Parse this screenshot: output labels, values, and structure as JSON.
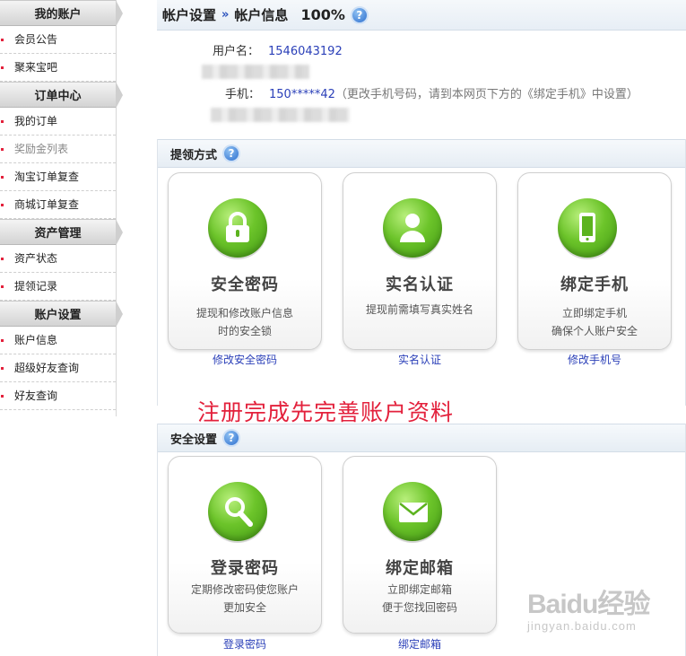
{
  "sidebar": {
    "groups": [
      {
        "title": "我的账户",
        "items": [
          "会员公告",
          "聚来宝吧"
        ]
      },
      {
        "title": "订单中心",
        "items": [
          "我的订单",
          "奖励金列表",
          "淘宝订单复查",
          "商城订单复查"
        ]
      },
      {
        "title": "资产管理",
        "items": [
          "资产状态",
          "提领记录"
        ]
      },
      {
        "title": "账户设置",
        "items": [
          "账户信息",
          "超级好友查询",
          "好友查询"
        ]
      }
    ]
  },
  "header": {
    "crumb1": "帐户设置",
    "sep": "»",
    "crumb2": "帐户信息",
    "percent": "100%",
    "help": "?"
  },
  "account": {
    "username_label": "用户名：",
    "username": "1546043192",
    "phone_label": "手机：",
    "phone": "150*****42",
    "phone_note": "（更改手机号码，请到本网页下方的《绑定手机》中设置）"
  },
  "withdraw": {
    "title": "提领方式",
    "help": "?",
    "cards": [
      {
        "title": "安全密码",
        "desc1": "提现和修改账户信息",
        "desc2": "时的安全锁",
        "link": "修改安全密码",
        "icon": "lock-icon"
      },
      {
        "title": "实名认证",
        "desc1": "提现前需填写真实姓名",
        "desc2": "",
        "link": "实名认证",
        "icon": "user-icon"
      },
      {
        "title": "绑定手机",
        "desc1": "立即绑定手机",
        "desc2": "确保个人账户安全",
        "link": "修改手机号",
        "icon": "phone-icon"
      }
    ]
  },
  "banner": "注册完成先完善账户资料",
  "security": {
    "title": "安全设置",
    "help": "?",
    "cards": [
      {
        "title": "登录密码",
        "desc1": "定期修改密码使您账户",
        "desc2": "更加安全",
        "link": "登录密码",
        "icon": "search-icon"
      },
      {
        "title": "绑定邮箱",
        "desc1": "立即绑定邮箱",
        "desc2": "便于您找回密码",
        "link": "绑定邮箱",
        "icon": "mail-icon"
      }
    ]
  },
  "watermark": {
    "big": "Baidu经验",
    "small": "jingyan.baidu.com"
  },
  "colors": {
    "accent_red": "#e3213c",
    "link_blue": "#2a3fb8",
    "icon_green": "#6cc42a",
    "help_blue": "#2d6fcf"
  }
}
